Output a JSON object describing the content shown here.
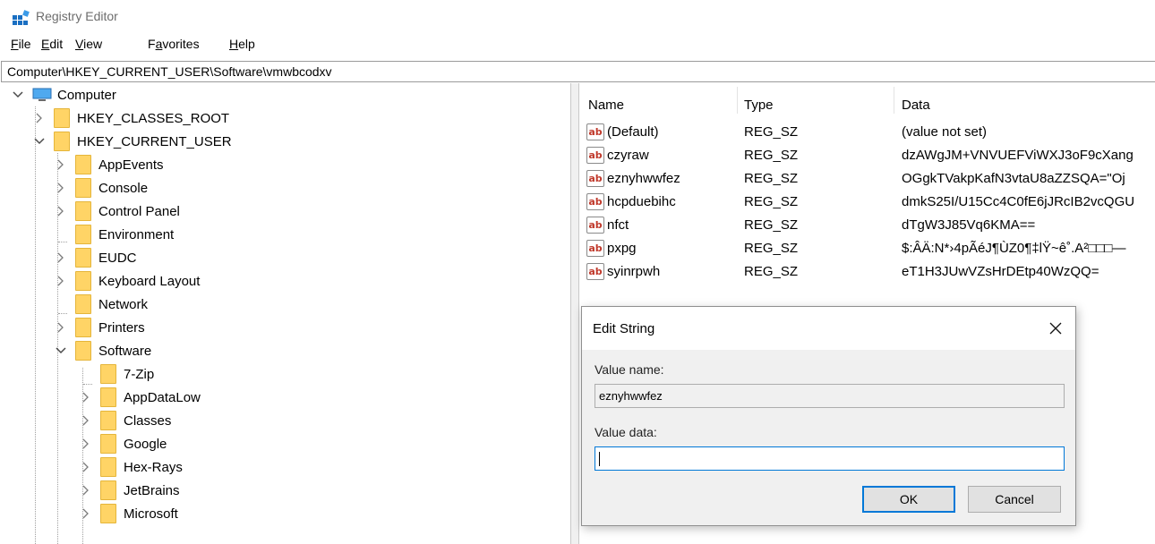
{
  "window": {
    "title": "Registry Editor",
    "icon": "registry-editor-icon"
  },
  "menu": [
    {
      "label": "File",
      "mnemonic": "F",
      "rest": "ile"
    },
    {
      "label": "Edit",
      "mnemonic": "E",
      "rest": "dit"
    },
    {
      "label": "View",
      "mnemonic": "V",
      "rest": "iew"
    },
    {
      "label": "Favorites",
      "mnemonic": "a",
      "pre": "F",
      "rest": "vorites"
    },
    {
      "label": "Help",
      "mnemonic": "H",
      "rest": "elp"
    }
  ],
  "address": "Computer\\HKEY_CURRENT_USER\\Software\\vmwbcodxv",
  "tree": {
    "root": "Computer",
    "items": [
      {
        "label": "HKEY_CLASSES_ROOT",
        "expander": "collapsed"
      },
      {
        "label": "HKEY_CURRENT_USER",
        "expander": "expanded"
      },
      {
        "label": "AppEvents",
        "expander": "collapsed"
      },
      {
        "label": "Console",
        "expander": "collapsed"
      },
      {
        "label": "Control Panel",
        "expander": "collapsed"
      },
      {
        "label": "Environment",
        "expander": "none"
      },
      {
        "label": "EUDC",
        "expander": "collapsed"
      },
      {
        "label": "Keyboard Layout",
        "expander": "collapsed"
      },
      {
        "label": "Network",
        "expander": "none"
      },
      {
        "label": "Printers",
        "expander": "collapsed"
      },
      {
        "label": "Software",
        "expander": "expanded"
      },
      {
        "label": "7-Zip",
        "expander": "none"
      },
      {
        "label": "AppDataLow",
        "expander": "collapsed"
      },
      {
        "label": "Classes",
        "expander": "collapsed"
      },
      {
        "label": "Google",
        "expander": "collapsed"
      },
      {
        "label": "Hex-Rays",
        "expander": "collapsed"
      },
      {
        "label": "JetBrains",
        "expander": "collapsed"
      },
      {
        "label": "Microsoft",
        "expander": "collapsed"
      }
    ]
  },
  "values": {
    "headers": {
      "name": "Name",
      "type": "Type",
      "data": "Data"
    },
    "rows": [
      {
        "name": "(Default)",
        "type": "REG_SZ",
        "data": "(value not set)"
      },
      {
        "name": "czyraw",
        "type": "REG_SZ",
        "data": "dzAWgJM+VNVUEFViWXJ3oF9cXang"
      },
      {
        "name": "eznyhwwfez",
        "type": "REG_SZ",
        "data": "OGgkTVakpKafN3vtaU8aZZSQA=\"Oj"
      },
      {
        "name": "hcpduebihc",
        "type": "REG_SZ",
        "data": "dmkS25I/U15Cc4C0fE6jJRcIB2vcQGU"
      },
      {
        "name": "nfct",
        "type": "REG_SZ",
        "data": "dTgW3J85Vq6KMA=="
      },
      {
        "name": "pxpg",
        "type": "REG_SZ",
        "data": "$:ÂÄ:N*›4pÃéJ¶ÙZ0¶‡lŸ~ê˚.A²□□□—"
      },
      {
        "name": "syinrpwh",
        "type": "REG_SZ",
        "data": "eT1H3JUwVZsHrDEtp40WzQQ="
      }
    ],
    "icon_label": "ab"
  },
  "dialog": {
    "title": "Edit String",
    "value_name_label": "Value name:",
    "value_name": "eznyhwwfez",
    "value_data_label": "Value data:",
    "value_data": "",
    "ok_label": "OK",
    "cancel_label": "Cancel"
  }
}
